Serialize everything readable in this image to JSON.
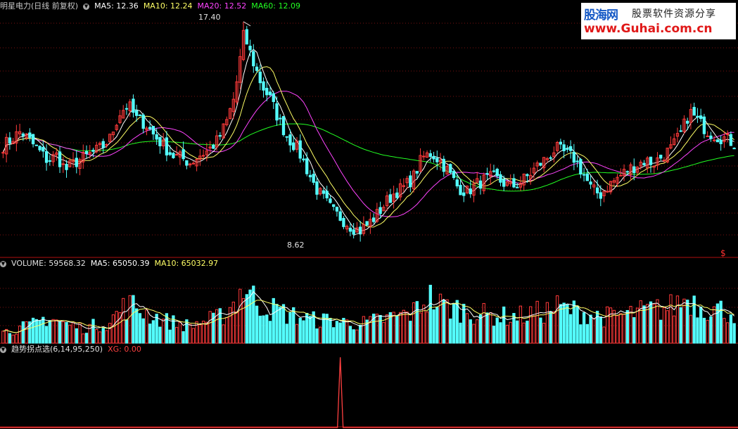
{
  "colors": {
    "up": "#ff3a3a",
    "down": "#54ffff",
    "ma5": "#ffffff",
    "ma10": "#ffff66",
    "ma20": "#ff44ff",
    "ma60": "#22ff22",
    "grid": "#7a1010",
    "divider": "#b01010",
    "stock_name": "#c8c8c8",
    "label_white": "#e0e0e0",
    "xg": "#ff4040"
  },
  "price_panel": {
    "stock_label": "明星电力(日线 前复权)",
    "ma5_label": "MA5: 12.36",
    "ma10_label": "MA10: 12.24",
    "ma20_label": "MA20: 12.52",
    "ma60_label": "MA60: 12.09",
    "high_label": "17.40",
    "low_label": "8.62",
    "corner_mark": "$"
  },
  "volume_panel": {
    "title": "VOLUME: 59568.32",
    "ma5_label": "MA5: 65050.39",
    "ma10_label": "MA10: 65032.97"
  },
  "indicator_panel": {
    "title": "趋势拐点选(6,14,95,250)",
    "xg_label": "XG: 0.00"
  },
  "watermark": {
    "brand": "股海网",
    "slogan": "股票软件资源分享",
    "url": "www.Guhai.com.cn"
  },
  "chart_data": [
    {
      "type": "candlestick",
      "y_unit": "price",
      "ylim": [
        8.0,
        18.0
      ],
      "high_marker": 17.4,
      "low_marker": 8.62,
      "ma_last": {
        "MA5": 12.36,
        "MA10": 12.24,
        "MA20": 12.52,
        "MA60": 12.09
      },
      "close_path": [
        12.3,
        12.6,
        12.9,
        12.5,
        12.1,
        11.7,
        11.9,
        11.3,
        11.6,
        11.8,
        12.0,
        12.2,
        12.6,
        13.6,
        14.0,
        13.4,
        13.2,
        12.7,
        12.3,
        11.9,
        11.8,
        11.6,
        11.9,
        12.1,
        12.5,
        13.2,
        14.4,
        16.9,
        15.8,
        14.8,
        14.2,
        13.3,
        12.6,
        12.2,
        11.4,
        10.6,
        10.1,
        9.6,
        9.3,
        9.0,
        8.8,
        9.1,
        9.5,
        10.0,
        10.4,
        10.6,
        11.0,
        11.8,
        12.0,
        11.7,
        11.2,
        10.6,
        10.4,
        10.7,
        10.9,
        11.0,
        10.8,
        10.6,
        10.8,
        11.1,
        11.5,
        11.8,
        12.2,
        12.0,
        11.8,
        11.2,
        10.5,
        10.3,
        10.7,
        11.0,
        11.3,
        11.5,
        11.7,
        11.6,
        11.9,
        12.2,
        12.8,
        13.7,
        13.3,
        12.9,
        12.7,
        12.6,
        12.4
      ],
      "volume_ylim": [
        0,
        200000
      ],
      "volume_path": [
        30,
        35,
        40,
        45,
        55,
        70,
        60,
        50,
        45,
        40,
        45,
        50,
        55,
        85,
        100,
        95,
        80,
        70,
        60,
        55,
        50,
        45,
        55,
        60,
        65,
        80,
        110,
        150,
        120,
        100,
        90,
        85,
        75,
        70,
        65,
        60,
        60,
        60,
        55,
        55,
        50,
        55,
        60,
        65,
        70,
        75,
        80,
        110,
        120,
        100,
        95,
        90,
        85,
        80,
        75,
        72,
        70,
        70,
        72,
        75,
        80,
        85,
        95,
        90,
        85,
        80,
        75,
        70,
        70,
        72,
        75,
        80,
        85,
        88,
        90,
        95,
        110,
        120,
        100,
        95,
        90,
        85,
        80
      ],
      "volume_last": {
        "VOLUME": 59568.32,
        "MA5": 65050.39,
        "MA10": 65032.97
      },
      "xg_signal_index": 38,
      "xg_value": 0.0
    }
  ]
}
